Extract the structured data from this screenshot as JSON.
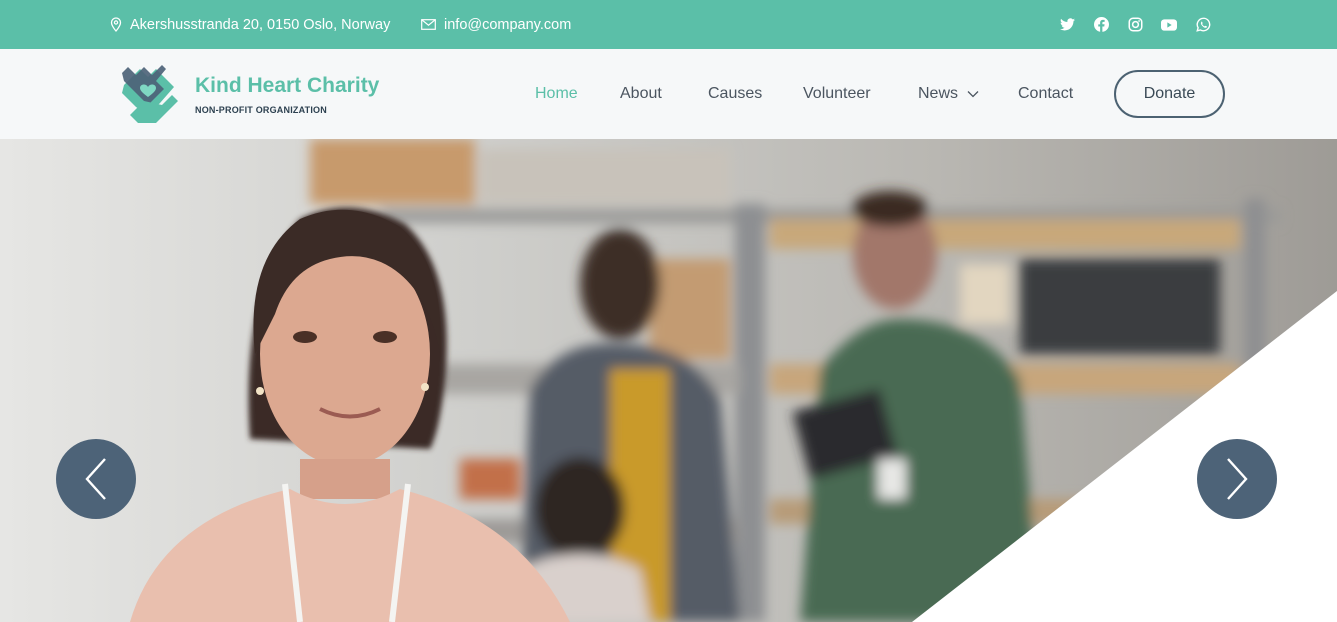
{
  "topbar": {
    "address": "Akershusstranda 20, 0150 Oslo, Norway",
    "email": "info@company.com",
    "socials": [
      "twitter-icon",
      "facebook-icon",
      "instagram-icon",
      "youtube-icon",
      "whatsapp-icon"
    ]
  },
  "brand": {
    "name": "Kind Heart Charity",
    "tagline": "NON-PROFIT ORGANIZATION"
  },
  "nav": {
    "items": [
      {
        "label": "Home",
        "active": true
      },
      {
        "label": "About"
      },
      {
        "label": "Causes"
      },
      {
        "label": "Volunteer"
      },
      {
        "label": "News",
        "has_dropdown": true
      },
      {
        "label": "Contact"
      }
    ],
    "donate_label": "Donate"
  },
  "hero": {
    "prev_icon": "chevron-left-icon",
    "next_icon": "chevron-right-icon"
  },
  "colors": {
    "accent": "#5bbfa8",
    "dark": "#4d6378",
    "text": "#4b5560"
  }
}
